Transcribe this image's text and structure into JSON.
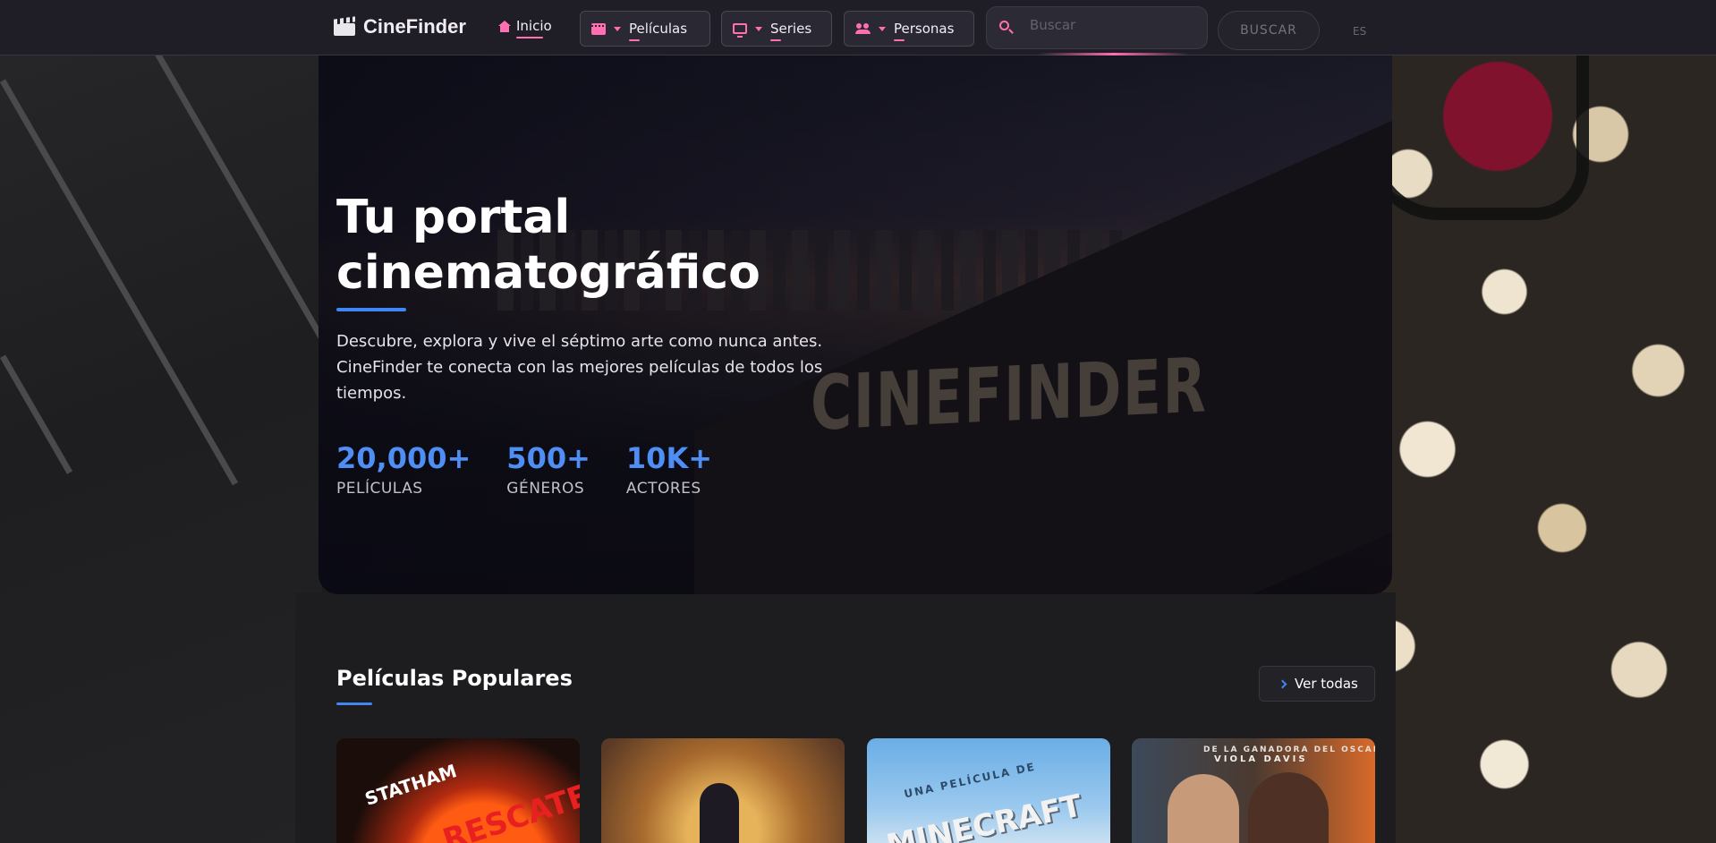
{
  "brand": {
    "name": "CineFinder",
    "icon": "clapperboard-icon"
  },
  "nav": {
    "home": {
      "label": "Inicio",
      "icon": "home-icon"
    },
    "items": [
      {
        "label": "Películas",
        "icon": "film-icon"
      },
      {
        "label": "Series",
        "icon": "tv-icon"
      },
      {
        "label": "Personas",
        "icon": "people-icon"
      }
    ],
    "search": {
      "placeholder": "Buscar",
      "value": ""
    },
    "search_button": "BUSCAR",
    "language": "ES"
  },
  "hero": {
    "title": "Tu portal cinematográfico",
    "description": "Descubre, explora y vive el séptimo arte como nunca antes. CineFinder te conecta con las mejores películas de todos los tiempos.",
    "sign": "CINEFINDER",
    "stats": [
      {
        "value": "20,000+",
        "label": "PELÍCULAS"
      },
      {
        "value": "500+",
        "label": "GÉNEROS"
      },
      {
        "value": "10K+",
        "label": "ACTORES"
      }
    ]
  },
  "popular": {
    "title": "Películas Populares",
    "view_all": "Ver todas",
    "posters": [
      {
        "lines": [
          "STATHAM",
          "RESCATE IMPLACABLE"
        ]
      },
      {
        "lines": []
      },
      {
        "lines": [
          "UNA PELÍCULA DE",
          "MINECRAFT"
        ]
      },
      {
        "lines": [
          "DE LA GANADORA DEL OSCAR",
          "VIOLA DAVIS"
        ]
      }
    ]
  },
  "colors": {
    "accent_pink": "#ff6fb1",
    "accent_blue": "#3f87f5",
    "stat_blue": "#4f8ff5",
    "nav_bg": "#1f1e27"
  }
}
